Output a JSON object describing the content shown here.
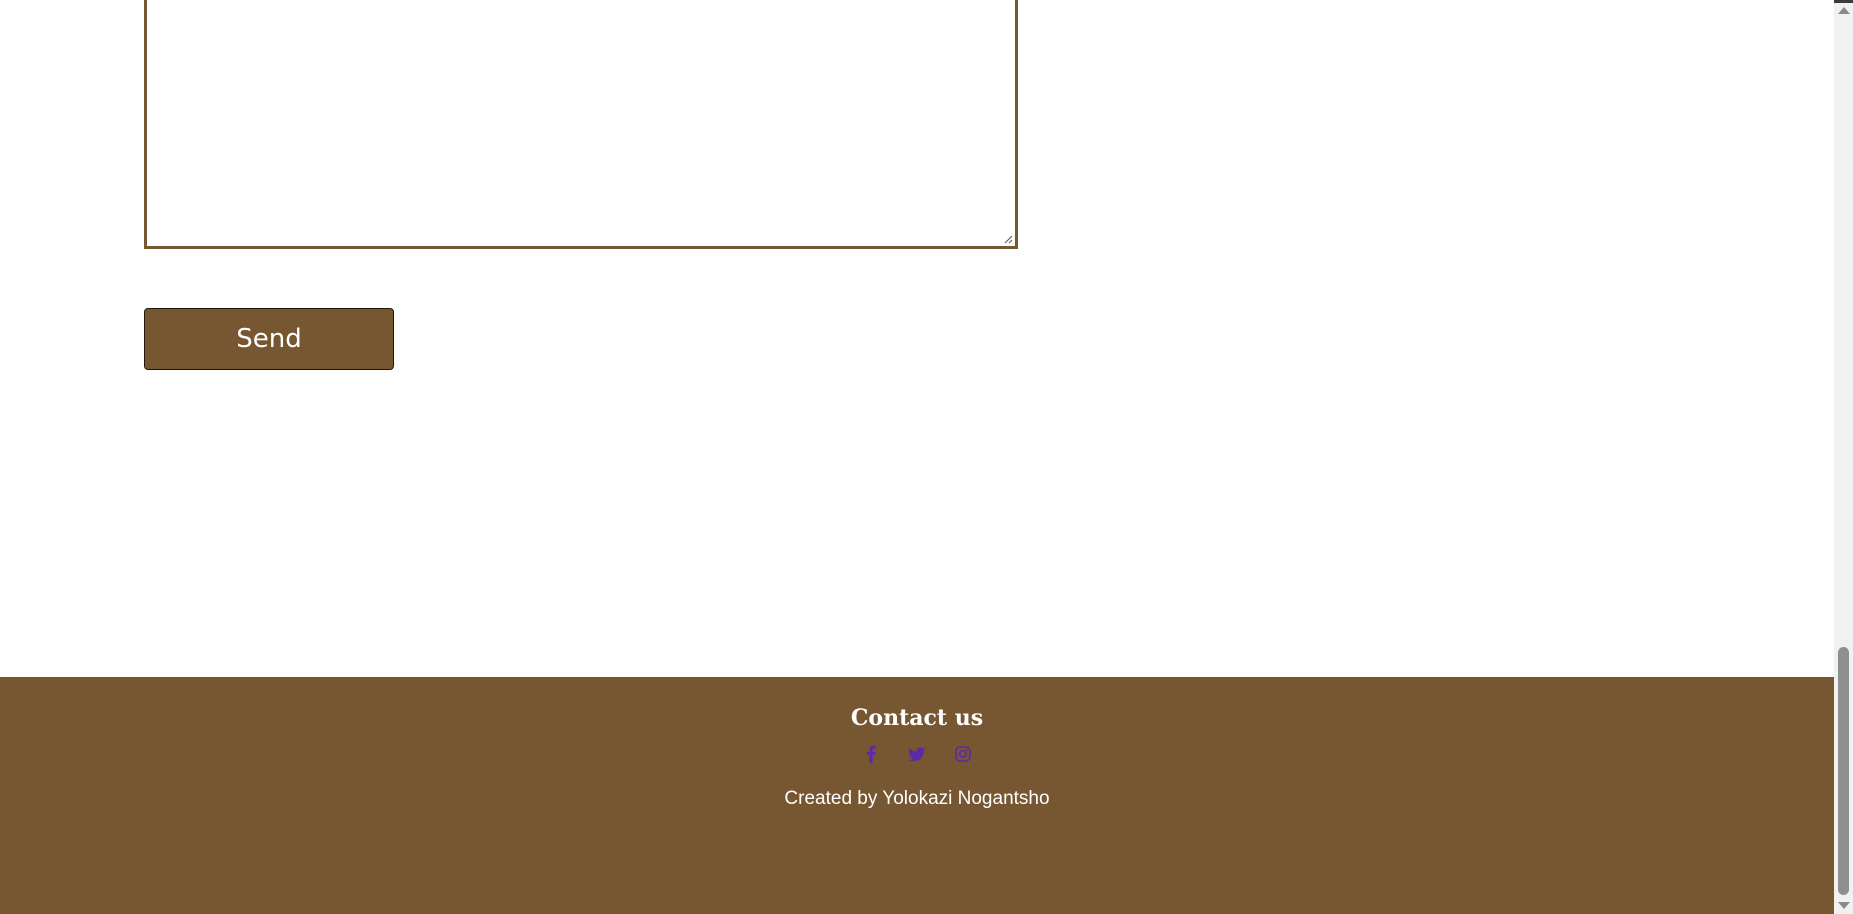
{
  "form": {
    "message_value": "",
    "send_label": "Send"
  },
  "footer": {
    "title": "Contact us",
    "social_links": [
      {
        "icon": "facebook-icon",
        "name": "facebook"
      },
      {
        "icon": "twitter-icon",
        "name": "twitter"
      },
      {
        "icon": "instagram-icon",
        "name": "instagram"
      }
    ],
    "credit": "Created by Yolokazi Nogantsho"
  },
  "colors": {
    "accent": "#765731",
    "background": "#fefefe",
    "footer_text": "#ffffff",
    "social_icon": "#5b2aa8"
  }
}
